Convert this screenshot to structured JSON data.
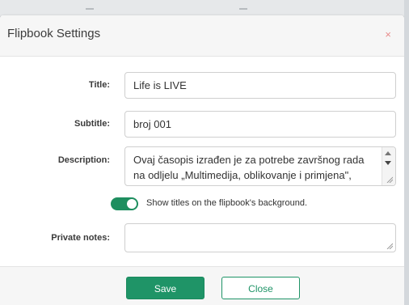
{
  "dialog": {
    "title": "Flipbook Settings",
    "close_glyph": "×"
  },
  "form": {
    "title_label": "Title:",
    "title_value": "Life is LIVE",
    "subtitle_label": "Subtitle:",
    "subtitle_value": "broj 001",
    "description_label": "Description:",
    "description_value": "Ovaj časopis izrađen je za potrebe završnog rada na odljelu „Multimedija, oblikovanje i primjena\", Sveučilišta Sjever",
    "show_titles_label": "Show titles on the flipbook's background.",
    "show_titles_enabled": true,
    "private_notes_label": "Private notes:",
    "private_notes_value": ""
  },
  "footer": {
    "save_label": "Save",
    "close_label": "Close"
  },
  "colors": {
    "accent": "#1f9467",
    "close_x": "#e88c8c"
  },
  "icons": {
    "close": "close-icon",
    "toggle": "toggle-switch",
    "scroll_up": "scroll-up-icon",
    "scroll_down": "scroll-down-icon",
    "resize": "resize-grip-icon"
  }
}
